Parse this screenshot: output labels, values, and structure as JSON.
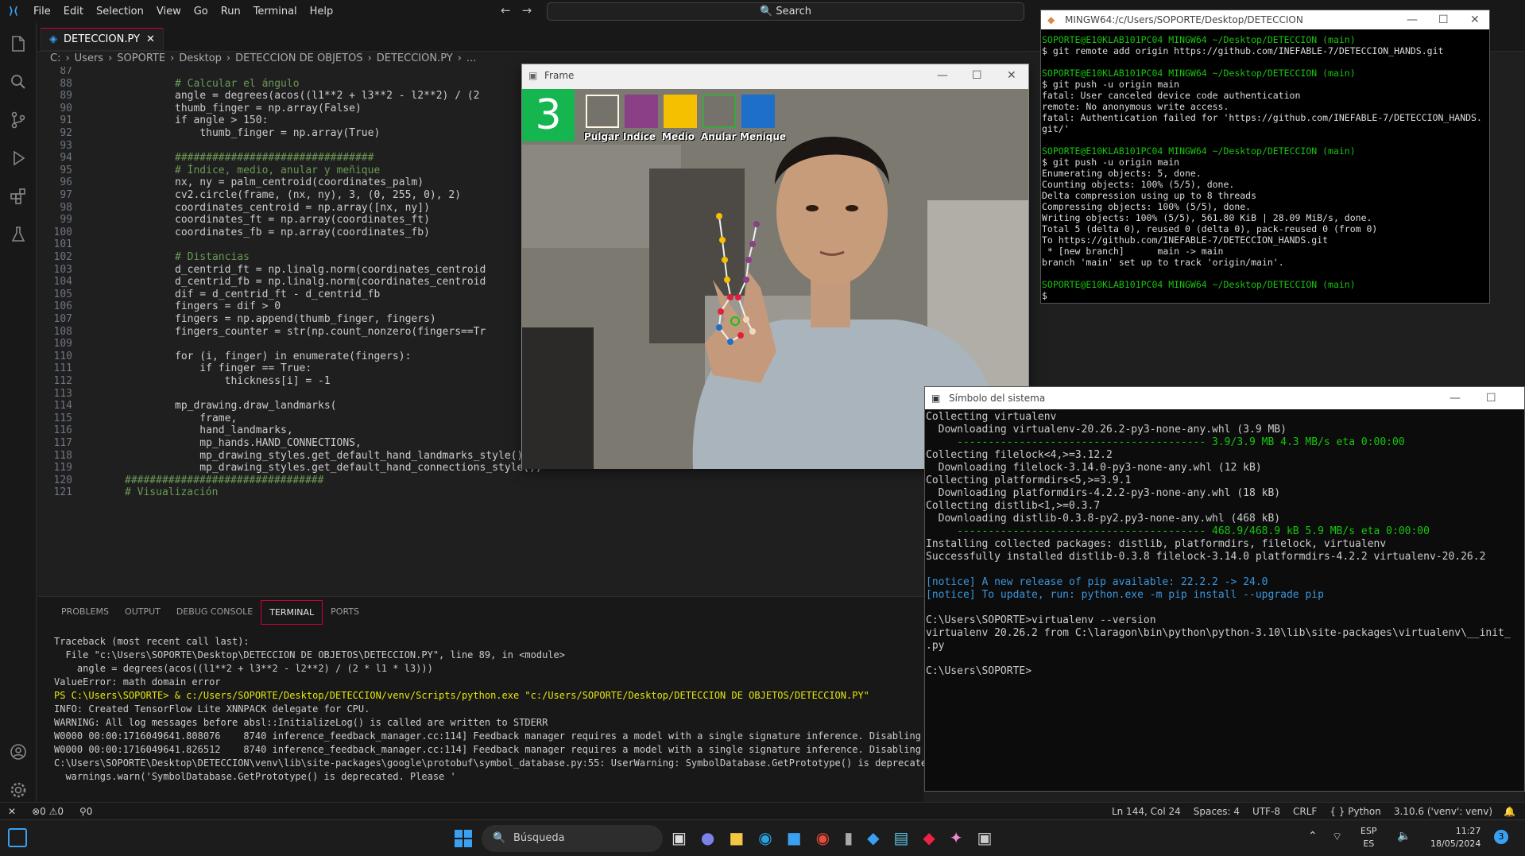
{
  "menu": [
    "File",
    "Edit",
    "Selection",
    "View",
    "Go",
    "Run",
    "Terminal",
    "Help"
  ],
  "search": "Search",
  "tab": {
    "name": "DETECCION.PY",
    "close": "✕"
  },
  "breadcrumb": [
    "C:",
    "Users",
    "SOPORTE",
    "Desktop",
    "DETECCION DE OBJETOS",
    "DETECCION.PY",
    "..."
  ],
  "code_lines": [
    {
      "n": "87",
      "t": ""
    },
    {
      "n": "88",
      "t": "# Calcular el ángulo"
    },
    {
      "n": "89",
      "t": "angle = degrees(acos((l1**2 + l3**2 - l2**2) / (2"
    },
    {
      "n": "90",
      "t": "thumb_finger = np.array(False)"
    },
    {
      "n": "91",
      "t": "if angle > 150:"
    },
    {
      "n": "92",
      "t": "    thumb_finger = np.array(True)"
    },
    {
      "n": "93",
      "t": ""
    },
    {
      "n": "94",
      "t": "################################"
    },
    {
      "n": "95",
      "t": "# Índice, medio, anular y meñique"
    },
    {
      "n": "96",
      "t": "nx, ny = palm_centroid(coordinates_palm)"
    },
    {
      "n": "97",
      "t": "cv2.circle(frame, (nx, ny), 3, (0, 255, 0), 2)"
    },
    {
      "n": "98",
      "t": "coordinates_centroid = np.array([nx, ny])"
    },
    {
      "n": "99",
      "t": "coordinates_ft = np.array(coordinates_ft)"
    },
    {
      "n": "100",
      "t": "coordinates_fb = np.array(coordinates_fb)"
    },
    {
      "n": "101",
      "t": ""
    },
    {
      "n": "102",
      "t": "# Distancias"
    },
    {
      "n": "103",
      "t": "d_centrid_ft = np.linalg.norm(coordinates_centroid"
    },
    {
      "n": "104",
      "t": "d_centrid_fb = np.linalg.norm(coordinates_centroid"
    },
    {
      "n": "105",
      "t": "dif = d_centrid_ft - d_centrid_fb"
    },
    {
      "n": "106",
      "t": "fingers = dif > 0"
    },
    {
      "n": "107",
      "t": "fingers = np.append(thumb_finger, fingers)"
    },
    {
      "n": "108",
      "t": "fingers_counter = str(np.count_nonzero(fingers==Tr"
    },
    {
      "n": "109",
      "t": ""
    },
    {
      "n": "110",
      "t": "for (i, finger) in enumerate(fingers):"
    },
    {
      "n": "111",
      "t": "    if finger == True:"
    },
    {
      "n": "112",
      "t": "        thickness[i] = -1"
    },
    {
      "n": "113",
      "t": ""
    },
    {
      "n": "114",
      "t": "mp_drawing.draw_landmarks("
    },
    {
      "n": "115",
      "t": "    frame,"
    },
    {
      "n": "116",
      "t": "    hand_landmarks,"
    },
    {
      "n": "117",
      "t": "    mp_hands.HAND_CONNECTIONS,"
    },
    {
      "n": "118",
      "t": "    mp_drawing_styles.get_default_hand_landmarks_style(),"
    },
    {
      "n": "119",
      "t": "    mp_drawing_styles.get_default_hand_connections_style())"
    },
    {
      "n": "120",
      "t": "################################"
    },
    {
      "n": "121",
      "t": "# Visualización"
    }
  ],
  "panel_tabs": [
    "PROBLEMS",
    "OUTPUT",
    "DEBUG CONSOLE",
    "TERMINAL",
    "PORTS"
  ],
  "terminal_lines": [
    "Traceback (most recent call last):",
    "  File \"c:\\Users\\SOPORTE\\Desktop\\DETECCION DE OBJETOS\\DETECCION.PY\", line 89, in <module>",
    "    angle = degrees(acos((l1**2 + l3**2 - l2**2) / (2 * l1 * l3)))",
    "ValueError: math domain error",
    "PS C:\\Users\\SOPORTE> & c:/Users/SOPORTE/Desktop/DETECCION/venv/Scripts/python.exe \"c:/Users/SOPORTE/Desktop/DETECCION DE OBJETOS/DETECCION.PY\"",
    "INFO: Created TensorFlow Lite XNNPACK delegate for CPU.",
    "WARNING: All log messages before absl::InitializeLog() is called are written to STDERR",
    "W0000 00:00:1716049641.808076    8740 inference_feedback_manager.cc:114] Feedback manager requires a model with a single signature inference. Disabling supp",
    "W0000 00:00:1716049641.826512    8740 inference_feedback_manager.cc:114] Feedback manager requires a model with a single signature inference. Disabling supp",
    "C:\\Users\\SOPORTE\\Desktop\\DETECCION\\venv\\lib\\site-packages\\google\\protobuf\\symbol_database.py:55: UserWarning: SymbolDatabase.GetPrototype() is deprecated. Pl",
    "  warnings.warn('SymbolDatabase.GetPrototype() is deprecated. Please '"
  ],
  "frame": {
    "title": "Frame",
    "count": "3",
    "fingers": [
      {
        "label": "Pulgar",
        "color": "#fff6e6",
        "filled": false
      },
      {
        "label": "Indice",
        "color": "#8a3f86",
        "filled": true
      },
      {
        "label": "Medio",
        "color": "#f5c000",
        "filled": true
      },
      {
        "label": "Anular",
        "color": "#3ea63e",
        "filled": false
      },
      {
        "label": "Menique",
        "color": "#1e6fc8",
        "filled": true
      }
    ]
  },
  "bash": {
    "title": "MINGW64:/c/Users/SOPORTE/Desktop/DETECCION",
    "lines": [
      {
        "t": "SOPORTE@E10KLAB101PC04 MINGW64 ~/Desktop/DETECCION (main)",
        "c": "prompt"
      },
      {
        "t": "$ git remote add origin https://github.com/INEFABLE-7/DETECCION_HANDS.git",
        "c": ""
      },
      {
        "t": "",
        "c": ""
      },
      {
        "t": "SOPORTE@E10KLAB101PC04 MINGW64 ~/Desktop/DETECCION (main)",
        "c": "prompt"
      },
      {
        "t": "$ git push -u origin main",
        "c": ""
      },
      {
        "t": "fatal: User canceled device code authentication",
        "c": ""
      },
      {
        "t": "remote: No anonymous write access.",
        "c": ""
      },
      {
        "t": "fatal: Authentication failed for 'https://github.com/INEFABLE-7/DETECCION_HANDS.",
        "c": ""
      },
      {
        "t": "git/'",
        "c": ""
      },
      {
        "t": "",
        "c": ""
      },
      {
        "t": "SOPORTE@E10KLAB101PC04 MINGW64 ~/Desktop/DETECCION (main)",
        "c": "prompt"
      },
      {
        "t": "$ git push -u origin main",
        "c": ""
      },
      {
        "t": "Enumerating objects: 5, done.",
        "c": ""
      },
      {
        "t": "Counting objects: 100% (5/5), done.",
        "c": ""
      },
      {
        "t": "Delta compression using up to 8 threads",
        "c": ""
      },
      {
        "t": "Compressing objects: 100% (5/5), done.",
        "c": ""
      },
      {
        "t": "Writing objects: 100% (5/5), 561.80 KiB | 28.09 MiB/s, done.",
        "c": ""
      },
      {
        "t": "Total 5 (delta 0), reused 0 (delta 0), pack-reused 0 (from 0)",
        "c": ""
      },
      {
        "t": "To https://github.com/INEFABLE-7/DETECCION_HANDS.git",
        "c": ""
      },
      {
        "t": " * [new branch]      main -> main",
        "c": ""
      },
      {
        "t": "branch 'main' set up to track 'origin/main'.",
        "c": ""
      },
      {
        "t": "",
        "c": ""
      },
      {
        "t": "SOPORTE@E10KLAB101PC04 MINGW64 ~/Desktop/DETECCION (main)",
        "c": "prompt"
      },
      {
        "t": "$ ",
        "c": ""
      }
    ]
  },
  "cmd": {
    "title": "Símbolo del sistema",
    "lines": [
      "Collecting virtualenv",
      "  Downloading virtualenv-20.26.2-py3-none-any.whl (3.9 MB)",
      "     ---------------------------------------- 3.9/3.9 MB 4.3 MB/s eta 0:00:00",
      "Collecting filelock<4,>=3.12.2",
      "  Downloading filelock-3.14.0-py3-none-any.whl (12 kB)",
      "Collecting platformdirs<5,>=3.9.1",
      "  Downloading platformdirs-4.2.2-py3-none-any.whl (18 kB)",
      "Collecting distlib<1,>=0.3.7",
      "  Downloading distlib-0.3.8-py2.py3-none-any.whl (468 kB)",
      "     ---------------------------------------- 468.9/468.9 kB 5.9 MB/s eta 0:00:00",
      "Installing collected packages: distlib, platformdirs, filelock, virtualenv",
      "Successfully installed distlib-0.3.8 filelock-3.14.0 platformdirs-4.2.2 virtualenv-20.26.2",
      "",
      "[notice] A new release of pip available: 22.2.2 -> 24.0",
      "[notice] To update, run: python.exe -m pip install --upgrade pip",
      "",
      "C:\\Users\\SOPORTE>virtualenv --version",
      "virtualenv 20.26.2 from C:\\laragon\\bin\\python\\python-3.10\\lib\\site-packages\\virtualenv\\__init_",
      ".py",
      "",
      "C:\\Users\\SOPORTE>"
    ]
  },
  "status": {
    "errors": "⊗0 ⚠0",
    "ports": "⚲0",
    "position": "Ln 144, Col 24",
    "spaces": "Spaces: 4",
    "encoding": "UTF-8",
    "eol": "CRLF",
    "language": "Python",
    "interpreter": "3.10.6 ('venv': venv)"
  },
  "taskbar": {
    "search": "Búsqueda",
    "lang1": "ESP",
    "lang2": "ES",
    "time": "11:27",
    "date": "18/05/2024",
    "badge": "3"
  }
}
